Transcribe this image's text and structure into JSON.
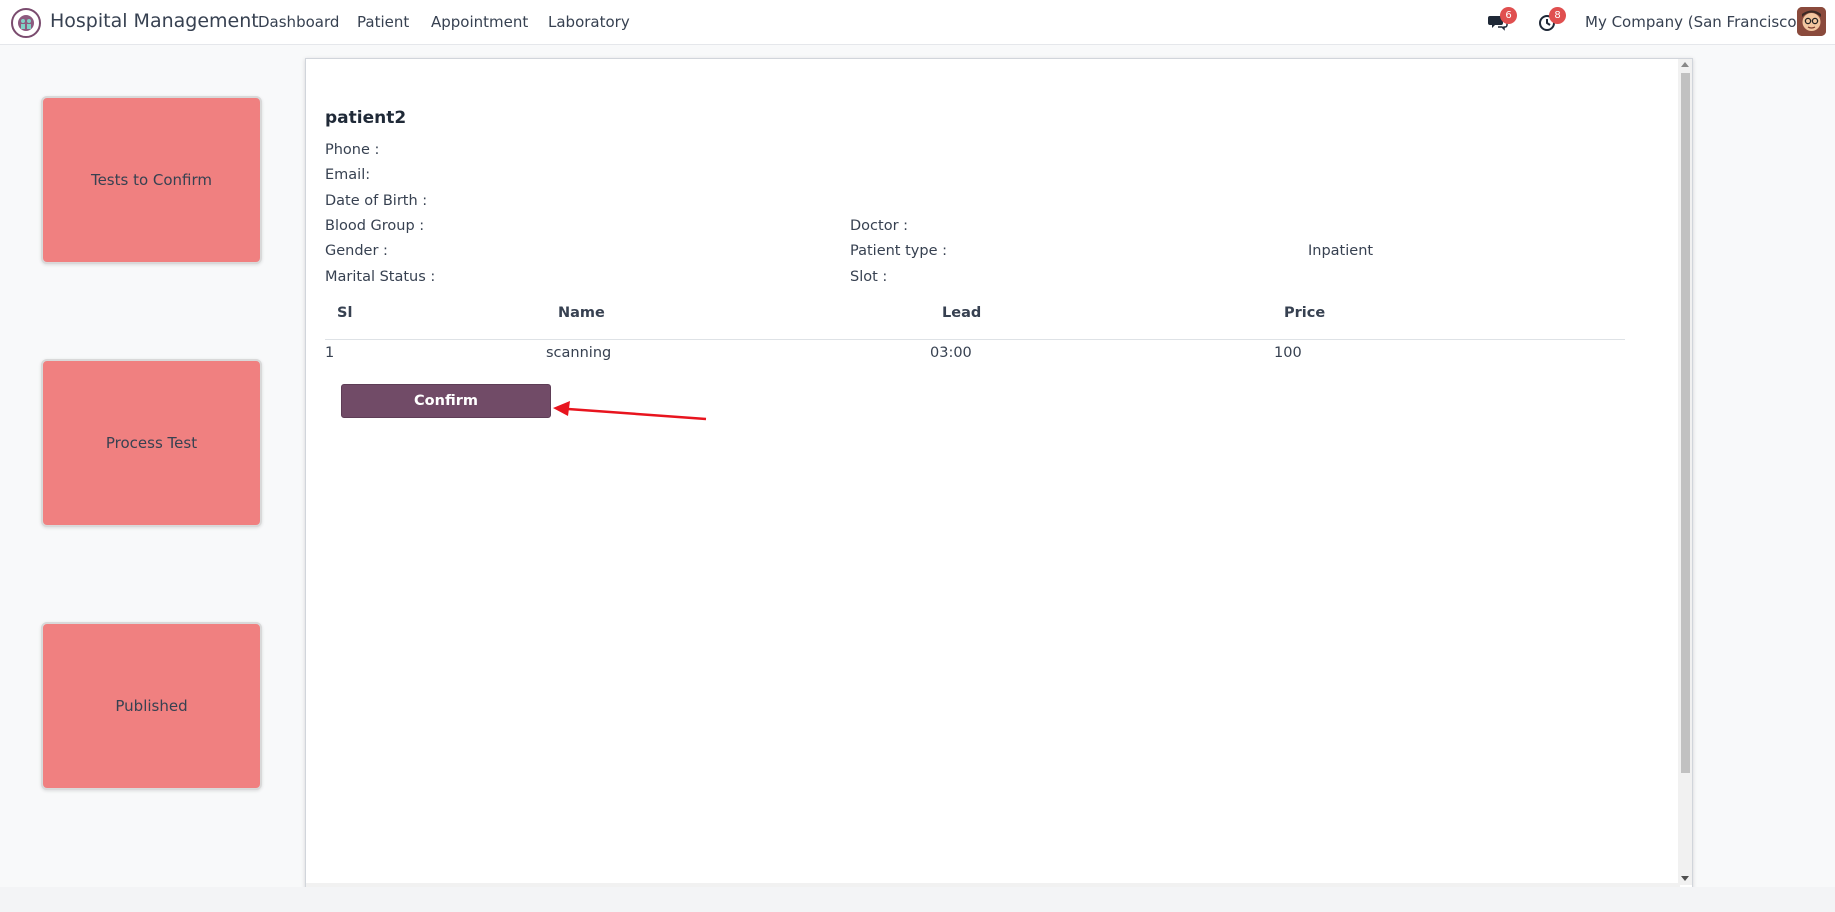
{
  "header": {
    "app_title": "Hospital Management",
    "nav": [
      "Dashboard",
      "Patient",
      "Appointment",
      "Laboratory"
    ],
    "messages_badge": "6",
    "activities_badge": "8",
    "company": "My Company (San Francisco)"
  },
  "tiles": [
    "Tests to Confirm",
    "Process Test",
    "Published"
  ],
  "patient": {
    "name": "patient2",
    "phone_label": "Phone :",
    "email_label": "Email:",
    "dob_label": "Date of Birth :",
    "blood_group_label": "Blood Group :",
    "gender_label": "Gender :",
    "marital_label": "Marital Status :",
    "doctor_label": "Doctor :",
    "patient_type_label": "Patient type :",
    "patient_type_value": "Inpatient",
    "slot_label": "Slot :"
  },
  "table": {
    "headers": [
      "Sl",
      "Name",
      "Lead",
      "Price"
    ],
    "rows": [
      [
        "1",
        "scanning",
        "03:00",
        "100"
      ]
    ]
  },
  "actions": {
    "confirm_label": "Confirm"
  },
  "colors": {
    "tile": "#f08080",
    "primary_button": "#714b67",
    "annotation_arrow": "#e8141e",
    "badge": "#e04f4f"
  }
}
